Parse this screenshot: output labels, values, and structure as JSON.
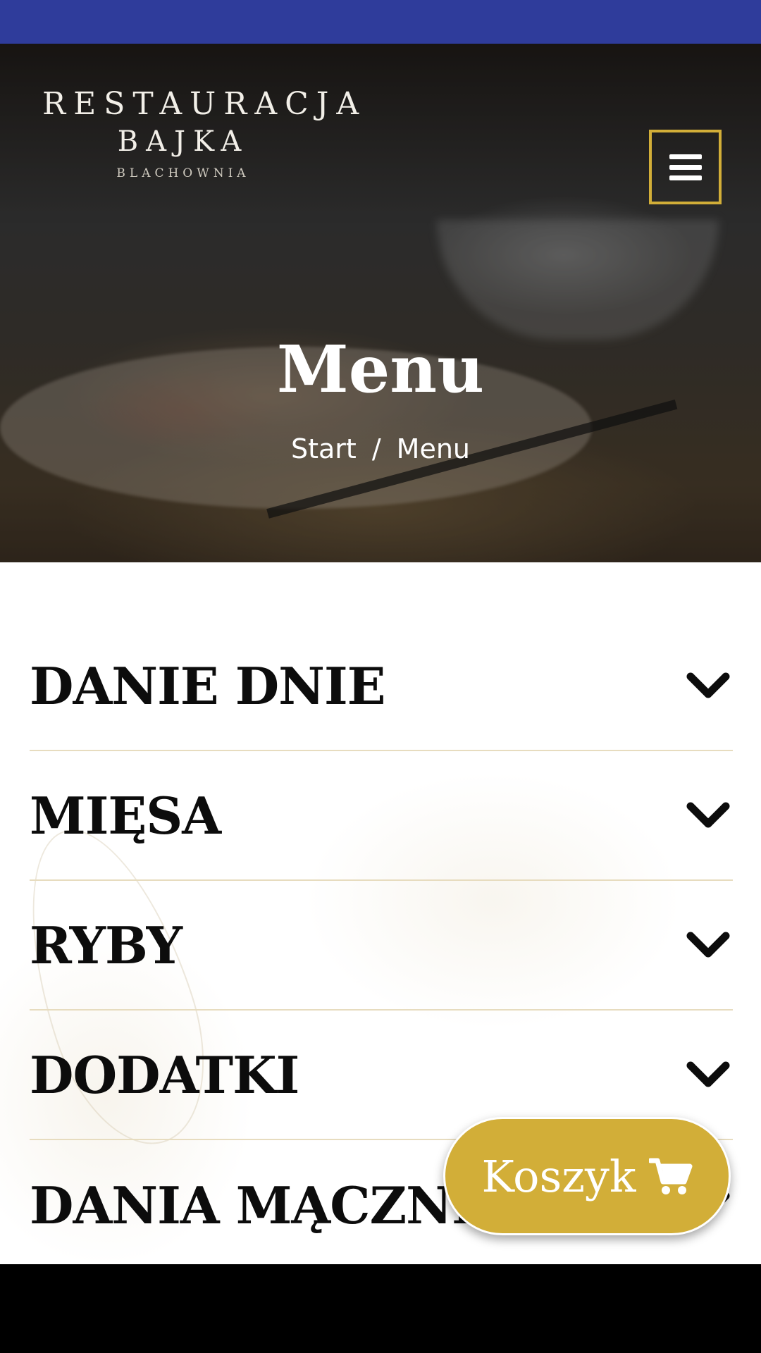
{
  "brand": {
    "line1": "RESTAURACJA",
    "line2": "BAJKA",
    "line3": "BLACHOWNIA"
  },
  "header": {
    "title": "Menu",
    "breadcrumb": {
      "home": "Start",
      "separator": "/",
      "current": "Menu"
    }
  },
  "categories": [
    {
      "label": "DANIE DNIE"
    },
    {
      "label": "MIĘSA"
    },
    {
      "label": "RYBY"
    },
    {
      "label": "DODATKI"
    },
    {
      "label": "DANIA MĄCZNE"
    }
  ],
  "cart": {
    "label": "Koszyk",
    "icon": "cart-icon"
  },
  "colors": {
    "status_bar": "#2f3c9b",
    "accent_gold": "#d2ae38",
    "divider": "#e7dcbf"
  },
  "icons": {
    "menu": "hamburger-icon",
    "expand": "chevron-down-icon"
  }
}
